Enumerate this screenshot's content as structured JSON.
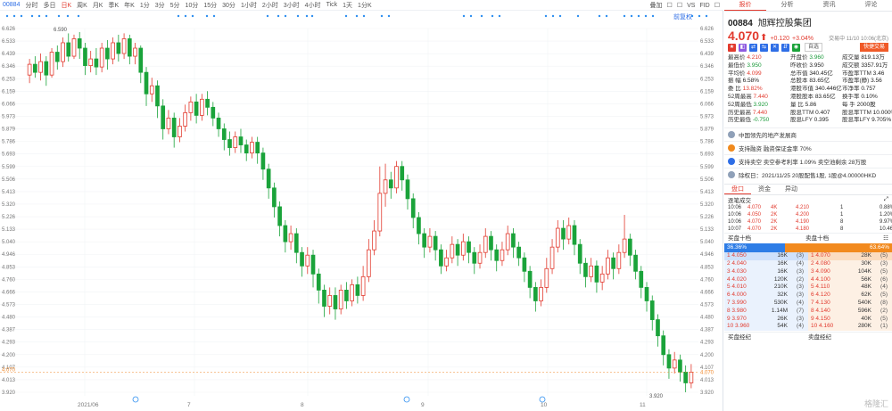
{
  "toolbar": {
    "code": "00884",
    "periods": [
      "分时",
      "多日",
      "日K",
      "周K",
      "月K",
      "季K",
      "年K",
      "1分",
      "3分",
      "5分",
      "10分",
      "15分",
      "30分",
      "1小时",
      "2小时",
      "3小时",
      "4小时",
      "Tick"
    ],
    "active_period": "日K",
    "adjust": "1天",
    "adjust2": "1分K",
    "right_items": [
      "叠加",
      "☐",
      "☐",
      "VS",
      "FID",
      "☐"
    ],
    "display_label": "叠加"
  },
  "restore_label": "前复权",
  "chart_data": {
    "type": "candlestick",
    "title": "",
    "y_ticks": [
      "6.626",
      "6.533",
      "6.439",
      "6.346",
      "6.253",
      "6.159",
      "6.066",
      "5.973",
      "5.879",
      "5.786",
      "5.693",
      "5.599",
      "5.506",
      "5.413",
      "5.320",
      "5.226",
      "5.133",
      "5.040",
      "4.946",
      "4.853",
      "4.760",
      "4.666",
      "4.573",
      "4.480",
      "4.387",
      "4.293",
      "4.200",
      "4.107",
      "4.013",
      "3.920"
    ],
    "ylim": [
      3.92,
      6.626
    ],
    "x_labels": [
      "2021/06",
      "7",
      "8",
      "9",
      "10",
      "11"
    ],
    "high_label": "6.590",
    "low_label": "3.920",
    "last_price_label": "4.070",
    "last_price": 4.07,
    "candles": [
      [
        6.28,
        6.36,
        6.22,
        6.4
      ],
      [
        6.36,
        6.3,
        6.26,
        6.42
      ],
      [
        6.3,
        6.38,
        6.24,
        6.44
      ],
      [
        6.38,
        6.28,
        6.2,
        6.42
      ],
      [
        6.28,
        6.45,
        6.26,
        6.48
      ],
      [
        6.45,
        6.38,
        6.32,
        6.5
      ],
      [
        6.38,
        6.52,
        6.34,
        6.56
      ],
      [
        6.52,
        6.42,
        6.38,
        6.59
      ],
      [
        6.42,
        6.55,
        6.4,
        6.58
      ],
      [
        6.55,
        6.48,
        6.4,
        6.6
      ],
      [
        6.48,
        6.35,
        6.28,
        6.52
      ],
      [
        6.35,
        6.4,
        6.3,
        6.46
      ],
      [
        6.4,
        6.34,
        6.28,
        6.48
      ],
      [
        6.34,
        6.48,
        6.3,
        6.52
      ],
      [
        6.48,
        6.4,
        6.32,
        6.54
      ],
      [
        6.4,
        6.52,
        6.36,
        6.56
      ],
      [
        6.52,
        6.44,
        6.38,
        6.58
      ],
      [
        6.44,
        6.55,
        6.4,
        6.59
      ],
      [
        6.55,
        6.42,
        6.36,
        6.58
      ],
      [
        6.42,
        6.48,
        6.36,
        6.52
      ],
      [
        6.48,
        6.3,
        6.22,
        6.5
      ],
      [
        6.3,
        6.14,
        6.05,
        6.34
      ],
      [
        6.14,
        6.2,
        6.08,
        6.26
      ],
      [
        6.2,
        6.05,
        5.96,
        6.24
      ],
      [
        6.05,
        5.88,
        5.8,
        6.1
      ],
      [
        5.88,
        5.96,
        5.84,
        6.02
      ],
      [
        5.96,
        5.82,
        5.74,
        6.0
      ],
      [
        5.82,
        5.9,
        5.78,
        5.96
      ],
      [
        5.9,
        6.0,
        5.86,
        6.06
      ],
      [
        6.0,
        6.08,
        5.94,
        6.12
      ],
      [
        6.08,
        5.98,
        5.92,
        6.14
      ],
      [
        5.98,
        6.1,
        5.94,
        6.14
      ],
      [
        6.1,
        6.04,
        5.98,
        6.16
      ],
      [
        6.04,
        5.96,
        5.9,
        6.08
      ],
      [
        5.96,
        5.88,
        5.82,
        6.0
      ],
      [
        5.88,
        5.8,
        5.72,
        5.92
      ],
      [
        5.8,
        5.74,
        5.68,
        5.86
      ],
      [
        5.74,
        5.82,
        5.7,
        5.86
      ],
      [
        5.82,
        5.76,
        5.7,
        5.88
      ],
      [
        5.76,
        5.7,
        5.64,
        5.8
      ],
      [
        5.7,
        5.78,
        5.66,
        5.82
      ],
      [
        5.78,
        5.7,
        5.62,
        5.82
      ],
      [
        5.7,
        5.58,
        5.5,
        5.74
      ],
      [
        5.58,
        5.44,
        5.36,
        5.62
      ],
      [
        5.44,
        5.3,
        5.22,
        5.48
      ],
      [
        5.3,
        5.16,
        5.08,
        5.34
      ],
      [
        5.16,
        5.04,
        4.96,
        5.2
      ],
      [
        5.04,
        5.1,
        4.98,
        5.16
      ],
      [
        5.1,
        4.96,
        4.88,
        5.14
      ],
      [
        4.96,
        4.86,
        4.78,
        5.0
      ],
      [
        4.86,
        4.94,
        4.8,
        5.0
      ],
      [
        4.94,
        4.8,
        4.7,
        4.98
      ],
      [
        4.8,
        4.68,
        4.58,
        4.84
      ],
      [
        4.68,
        4.56,
        4.48,
        4.72
      ],
      [
        4.56,
        4.64,
        4.5,
        4.7
      ],
      [
        4.64,
        4.54,
        4.46,
        4.7
      ],
      [
        4.54,
        4.68,
        4.5,
        4.72
      ],
      [
        4.68,
        4.6,
        4.54,
        4.74
      ],
      [
        4.6,
        4.72,
        4.56,
        4.76
      ],
      [
        4.72,
        4.64,
        4.58,
        4.78
      ],
      [
        4.64,
        4.78,
        4.6,
        4.86
      ],
      [
        4.78,
        4.98,
        4.74,
        5.06
      ],
      [
        4.98,
        5.12,
        4.94,
        5.2
      ],
      [
        5.12,
        5.4,
        5.08,
        5.6
      ],
      [
        5.4,
        5.5,
        5.3,
        5.62
      ],
      [
        5.5,
        5.44,
        5.36,
        5.56
      ],
      [
        5.44,
        5.6,
        5.4,
        5.64
      ],
      [
        5.6,
        5.5,
        5.42,
        5.64
      ],
      [
        5.5,
        5.36,
        5.28,
        5.54
      ],
      [
        5.36,
        5.22,
        5.14,
        5.4
      ],
      [
        5.22,
        5.1,
        5.02,
        5.26
      ],
      [
        5.1,
        5.0,
        4.92,
        5.14
      ],
      [
        5.0,
        5.08,
        4.96,
        5.14
      ],
      [
        5.08,
        4.98,
        4.9,
        5.12
      ],
      [
        4.98,
        4.86,
        4.8,
        5.02
      ],
      [
        4.86,
        4.92,
        4.82,
        4.98
      ],
      [
        4.92,
        5.02,
        4.88,
        5.08
      ],
      [
        5.02,
        4.94,
        4.86,
        5.06
      ],
      [
        4.94,
        5.04,
        4.9,
        5.1
      ],
      [
        5.04,
        4.96,
        4.88,
        5.08
      ],
      [
        4.96,
        4.88,
        4.8,
        5.0
      ],
      [
        4.88,
        4.96,
        4.84,
        5.02
      ],
      [
        4.96,
        5.08,
        4.92,
        5.14
      ],
      [
        5.08,
        4.98,
        4.9,
        5.12
      ],
      [
        4.98,
        4.9,
        4.82,
        5.02
      ],
      [
        4.9,
        4.98,
        4.86,
        5.04
      ],
      [
        4.98,
        5.1,
        4.94,
        5.16
      ],
      [
        5.1,
        5.0,
        4.92,
        5.14
      ],
      [
        5.0,
        4.92,
        4.86,
        5.04
      ],
      [
        4.92,
        4.82,
        4.74,
        4.96
      ],
      [
        4.82,
        4.7,
        4.62,
        4.86
      ],
      [
        4.7,
        4.6,
        4.52,
        4.74
      ],
      [
        4.6,
        4.7,
        4.56,
        4.76
      ],
      [
        4.7,
        4.84,
        4.66,
        4.92
      ],
      [
        4.84,
        5.0,
        4.8,
        5.06
      ],
      [
        5.0,
        5.14,
        4.96,
        5.2
      ],
      [
        5.14,
        5.06,
        4.98,
        5.2
      ],
      [
        5.06,
        5.16,
        5.02,
        5.22
      ],
      [
        5.16,
        5.02,
        4.94,
        5.2
      ],
      [
        5.02,
        4.88,
        4.8,
        5.06
      ],
      [
        4.88,
        4.78,
        4.7,
        4.92
      ],
      [
        4.78,
        4.86,
        4.74,
        4.92
      ],
      [
        4.86,
        4.74,
        4.66,
        4.9
      ],
      [
        4.74,
        4.8,
        4.68,
        4.86
      ],
      [
        4.8,
        4.92,
        4.76,
        4.98
      ],
      [
        4.92,
        4.84,
        4.76,
        4.96
      ],
      [
        4.84,
        4.96,
        4.8,
        5.02
      ],
      [
        4.96,
        5.06,
        4.92,
        5.24
      ],
      [
        5.06,
        4.94,
        4.86,
        5.1
      ],
      [
        4.94,
        4.82,
        4.76,
        4.98
      ],
      [
        4.82,
        4.7,
        4.62,
        4.86
      ],
      [
        4.7,
        4.6,
        4.52,
        4.74
      ],
      [
        4.6,
        4.46,
        4.38,
        4.64
      ],
      [
        4.46,
        4.34,
        4.26,
        4.5
      ],
      [
        4.34,
        4.2,
        4.12,
        4.38
      ],
      [
        4.2,
        4.1,
        4.02,
        4.24
      ],
      [
        4.1,
        4.16,
        4.06,
        4.22
      ],
      [
        4.16,
        4.07,
        4.0,
        4.2
      ],
      [
        4.07,
        3.99,
        3.92,
        4.12
      ],
      [
        3.99,
        4.07,
        3.95,
        4.13
      ]
    ],
    "colors": {
      "up": "#e23a2e",
      "down": "#1aa33a",
      "last_line": "#f08a2e"
    }
  },
  "quote": {
    "tabs": [
      "报价",
      "分析",
      "资讯",
      "评论"
    ],
    "active_tab": "报价",
    "code": "00884",
    "name": "旭辉控股集团",
    "price": "4.070",
    "arrow": "⬆",
    "change": "+0.120",
    "change_pct": "+3.04%",
    "timestamp": "交易中 11/10 10:06(北京)",
    "follow_label": "自选",
    "trade_label": "快捷交易",
    "stats": [
      [
        "最高价",
        "4.210",
        "v-red"
      ],
      [
        "开盘价",
        "3.960",
        "v-green"
      ],
      [
        "成交量",
        "819.13万",
        "v-dark"
      ],
      [
        "最低价",
        "3.950",
        "v-green"
      ],
      [
        "昨收价",
        "3.950",
        "v-dark"
      ],
      [
        "成交额",
        "3357.91万",
        "v-dark"
      ],
      [
        "平均价",
        "4.099",
        "v-red"
      ],
      [
        "总市值",
        "340.45亿",
        "v-dark"
      ],
      [
        "市盈率TTM",
        "3.46",
        "v-dark"
      ],
      [
        "振    幅",
        "6.58%",
        "v-dark"
      ],
      [
        "总股本",
        "83.65亿",
        "v-dark"
      ],
      [
        "市盈率(静)",
        "3.56",
        "v-dark"
      ],
      [
        "委    比",
        "13.82%",
        "v-red"
      ],
      [
        "港股市值",
        "340.446亿",
        "v-dark"
      ],
      [
        "市净率",
        "0.757",
        "v-dark"
      ],
      [
        "52周最高",
        "7.440",
        "v-red"
      ],
      [
        "港股股本",
        "83.65亿",
        "v-dark"
      ],
      [
        "换手率",
        "0.10%",
        "v-dark"
      ],
      [
        "52周最低",
        "3.920",
        "v-green"
      ],
      [
        "量    比",
        "5.86",
        "v-dark"
      ],
      [
        "每    手",
        "2000股",
        "v-dark"
      ],
      [
        "历史最高",
        "7.440",
        "v-red"
      ],
      [
        "股息TTM",
        "0.407",
        "v-dark"
      ],
      [
        "股息率TTM",
        "10.000%",
        "v-dark"
      ],
      [
        "历史最低",
        "-0.750",
        "v-green"
      ],
      [
        "股息LFY",
        "0.395",
        "v-dark"
      ],
      [
        "股息率LFY",
        "9.705%",
        "v-dark"
      ]
    ],
    "notes": [
      {
        "text": "中国领先的地产发展商",
        "color": "#8fa0b8"
      },
      {
        "text": "支持融资  融资保证金率 70%",
        "color": "#f08a1e"
      },
      {
        "text": "支持卖空  卖空参考利率 1.09%  卖空池剩余 28万股",
        "color": "#2e6ee6"
      },
      {
        "text": "除权日：2021/11/25  20股配售1股, 1股@4.00000HKD",
        "color": "#8fa0b8"
      }
    ],
    "sub_tabs": [
      "盘口",
      "资金",
      "异动"
    ],
    "active_sub_tab": "盘口",
    "deals_title": "逐笔成交",
    "deals": [
      [
        "10:06",
        "4.070",
        "4K",
        "4.210",
        "1",
        "0.88%"
      ],
      [
        "10:06",
        "4.050",
        "2K",
        "4.200",
        "1",
        "1.20%"
      ],
      [
        "10:06",
        "4.070",
        "2K",
        "4.190",
        "8",
        "9.97%"
      ],
      [
        "10:07",
        "4.070",
        "2K",
        "4.180",
        "8",
        "10.46%"
      ]
    ],
    "book_title_bid": "买盘十档",
    "book_title_ask": "卖盘十档",
    "bid_ratio": "36.36%",
    "ask_ratio": "63.64%",
    "bids": [
      [
        "4.050",
        "16K",
        "3"
      ],
      [
        "4.040",
        "16K",
        "4"
      ],
      [
        "4.030",
        "16K",
        "3"
      ],
      [
        "4.020",
        "120K",
        "2"
      ],
      [
        "4.010",
        "210K",
        "3"
      ],
      [
        "4.000",
        "32K",
        "3"
      ],
      [
        "3.990",
        "530K",
        "4"
      ],
      [
        "3.980",
        "1.14M",
        "7"
      ],
      [
        "3.970",
        "26K",
        "3"
      ],
      [
        "3.960",
        "54K",
        "4"
      ]
    ],
    "asks": [
      [
        "4.070",
        "28K",
        "5"
      ],
      [
        "4.080",
        "30K",
        "3"
      ],
      [
        "4.090",
        "104K",
        "5"
      ],
      [
        "4.100",
        "56K",
        "6"
      ],
      [
        "4.110",
        "48K",
        "4"
      ],
      [
        "4.120",
        "62K",
        "5"
      ],
      [
        "4.130",
        "540K",
        "8"
      ],
      [
        "4.140",
        "596K",
        "2"
      ],
      [
        "4.150",
        "40K",
        "5"
      ],
      [
        "4.160",
        "280K",
        "1"
      ]
    ],
    "broker_bid": "买盘经纪",
    "broker_ask": "卖盘经纪",
    "watermark": "格隆汇"
  }
}
